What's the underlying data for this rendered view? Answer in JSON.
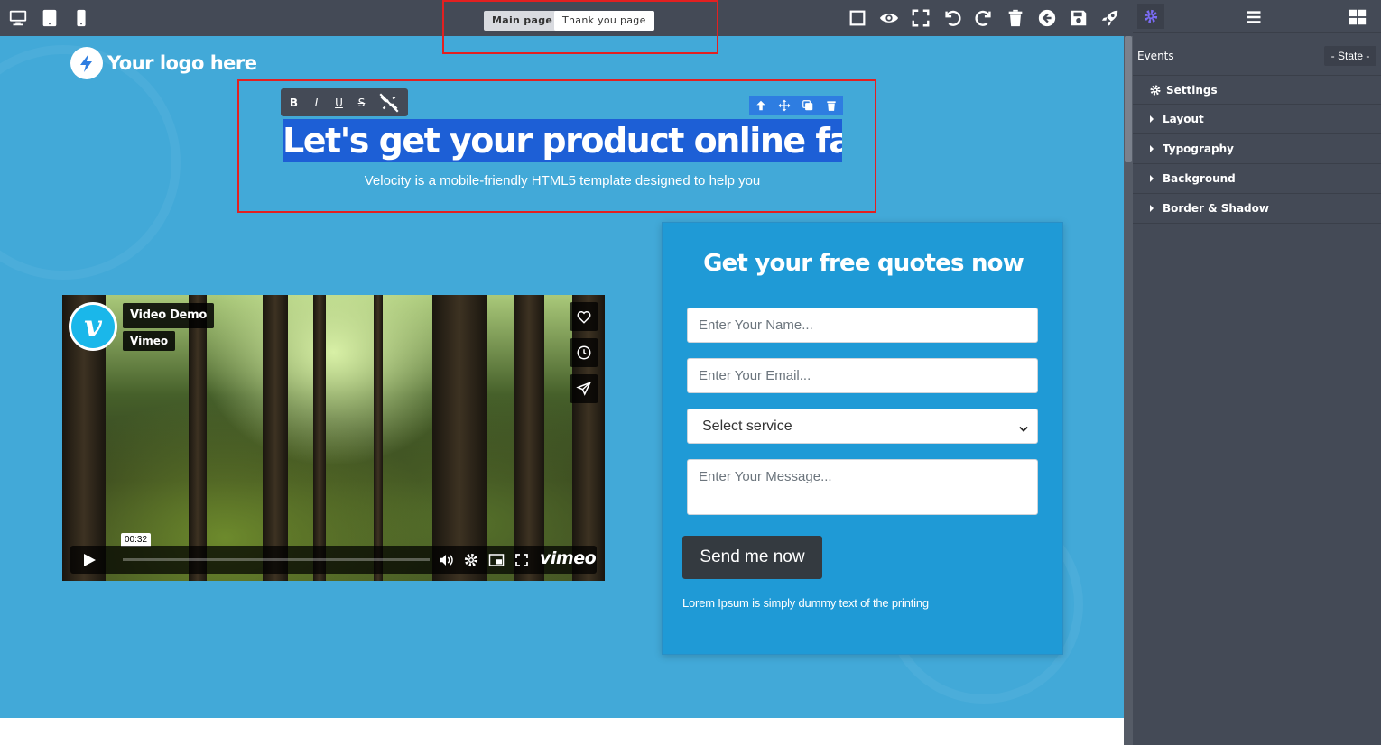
{
  "topbar": {
    "device_icons": [
      "desktop-icon",
      "tablet-icon",
      "mobile-icon"
    ],
    "pages": [
      {
        "label": "Main page",
        "active": true
      },
      {
        "label": "Thank you page",
        "active": false
      }
    ],
    "tool_icons": [
      "square-icon",
      "eye-icon",
      "fullscreen-icon",
      "undo-icon",
      "redo-icon",
      "trash-icon",
      "arrow-left-circle-icon",
      "save-icon",
      "rocket-icon"
    ]
  },
  "right_panel": {
    "tab_icons": [
      "gear-icon",
      "menu-icon",
      "blocks-icon"
    ],
    "events_label": "Events",
    "state_label": "- State -",
    "sections": [
      {
        "label": "Settings",
        "icon": "gear-icon"
      },
      {
        "label": "Layout"
      },
      {
        "label": "Typography"
      },
      {
        "label": "Background"
      },
      {
        "label": "Border & Shadow"
      }
    ]
  },
  "canvas": {
    "logo_text": "Your logo here",
    "rte_buttons": [
      "B",
      "I",
      "U",
      "S"
    ],
    "hero": {
      "title": "Let's get your product online fast",
      "subtitle": "Velocity is a mobile-friendly HTML5 template designed to help you"
    },
    "video": {
      "title": "Video Demo",
      "owner": "Vimeo",
      "time": "00:32",
      "brand": "vimeo",
      "badge_letter": "v",
      "progress": 0
    },
    "form": {
      "title": "Get your free quotes now",
      "name_placeholder": "Enter Your Name...",
      "email_placeholder": "Enter Your Email...",
      "service_label": "Select service",
      "message_placeholder": "Enter Your Message...",
      "submit_label": "Send me now",
      "note": "Lorem Ipsum is simply dummy text of the printing"
    }
  },
  "colors": {
    "canvas_bg": "#42a9d8",
    "toolbar_bg": "#444a56",
    "form_bg": "#1f9ad6",
    "selection": "#1d5fd6",
    "highlight_border": "#e32020",
    "accent_purple": "#7b6cf6"
  }
}
